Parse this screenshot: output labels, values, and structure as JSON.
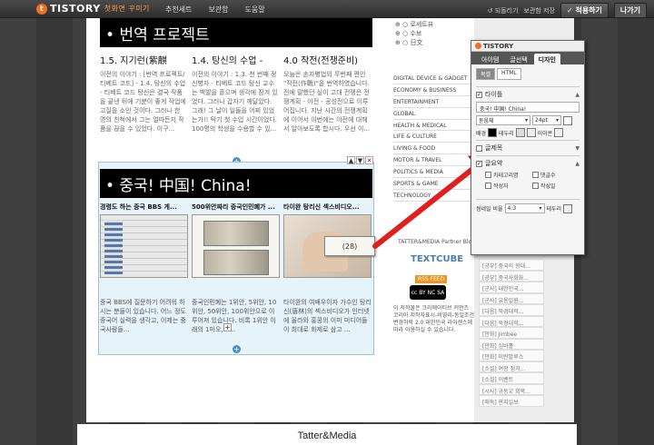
{
  "topbar": {
    "logo": "TISTORY",
    "logo_sub": "첫화면 꾸미기",
    "nav": [
      "추천세트",
      "보관함",
      "도움말"
    ],
    "undo": "되돌리기",
    "save_store": "보관함 저장",
    "apply": "적용하기",
    "exit": "나가기"
  },
  "blog": {
    "banner1": "• 번역 프로젝트",
    "posts1": [
      {
        "title": "1.5. 지기런(紫麒",
        "body": "이전의 이야기 : [번역 프로젝트/티베트 코드] - 1.4. 탕신의 수업 - 티베트 코드 탕신은 결국 작품을 끝낸 뒤에 기분이 좋게 작업에 고질을 소인 것이다. 그러나 한 명의 친척에서 그는 얼마든지 작품을 끊을 수 있었다. 이구..."
      },
      {
        "title": "1.4. 탕신의 수업 -",
        "body": "이전의 이야기 : 1.3. 천 번째 정신병자 - 티베트 코드 탕신 교수는 백발을 흩으며 생각에 잠겨 있었다. 그러나 갑자기 깨달았다. 그래! 그 날이 일들을 어찌 있었는가!! 탁기 첫 수업 시간이었다. 100명의 학생을 수용할 수 있..."
      },
      {
        "title": "4.0 작전(전쟁준비)",
        "body": "오늘은 손자병법의 무번째 편인 \"작전(作戰)\"을 번역하였습니다. 전에 말했던 싶이 고대 전쟁은 전쟁계획 - 야전 - 공성전으로 이루어집니다. 지난 시간의 전쟁계획에 이어서 이번에는 야전에 대해서 알아보도록 합시다. 우선 이..."
      }
    ],
    "banner2": "• 중국! 中国! China!",
    "posts2": [
      {
        "title": "경령도 하는 중국 BBS 게...",
        "body": "중국 BBS에 질문하기 어려워 하시는 분들이 있습니다. 어느 정도 중국어 실력을 생각고, 이제는 중국사람들..."
      },
      {
        "title": "500위안짜리 중국인민폐가 ...",
        "body": "중국인민폐는 1위안, 5위안, 10위안, 50위안, 100위안으로 이루어져 있습니다. 비록 1위안 이래의 1마오, 5..."
      },
      {
        "title": "타이완 탕리신 섹스비디오...",
        "body": "타이완의 여배우이자 가수인 탕리신(唐林)의 섹스비디오가 인터넷에 올라와 홍콩의 이미 미디어들이 최대로 화제로 삼고 ..."
      }
    ],
    "tooltip": "(28)",
    "footer": "Tatter&Media"
  },
  "sidebar": {
    "top_items": [
      "로세트뷰",
      "수보",
      "日文"
    ],
    "categories": [
      "DIGITAL DEVICE & GADGET",
      "ECONOMY & BUSINESS",
      "ENTERTAINMENT",
      "GLOBAL",
      "HEALTH & MEDICAL",
      "LIFE & CULTURE",
      "LIVING & FOOD",
      "MOTOR & TRAVEL",
      "POLITICS & MEDIA",
      "SPORTS & GAME",
      "TECHNOLOGY"
    ],
    "partner": "TATTER&MEDIA Partner Blog",
    "textcube": "TEXTCUBE",
    "rss": "RSS FEED",
    "cc": "cc BY NC SA",
    "license": "이 저작물은 크리에이티브 커먼즈 코리아 저작자표시-비영리-동일조건변경허락 2.0 대한민국 라이센스에 따라 이용하실 수 있습니다.",
    "right_list": [
      "[공부] 중국의 왕대...",
      "[공부] 중국사회화...",
      "[군사] 대한민국...",
      "[군사] 유용일원...",
      "[다음] 북경대학...",
      "[다음] 북경대학...",
      "[만화] Jimbee",
      "[만화] 심바홀",
      "[만화] 미란발루스",
      "[소설] 여왕 정치...",
      "[소설] 이벤트",
      "[시사] 규동교 회복...",
      "[애독] 판지일보"
    ]
  },
  "panel": {
    "title": "TISTORY",
    "tabs": [
      "아이템",
      "글선택",
      "디자인"
    ],
    "subtabs": [
      "복셀",
      "HTML"
    ],
    "section_title": "타이틀",
    "title_value": "중국! 中国! China!",
    "font": "돋움체",
    "size": "24pt",
    "bg_label": "배경",
    "border_label": "테두리",
    "icon_label": "이이콘",
    "section_list": "글제목",
    "section_summary": "글요약",
    "options": [
      "카테고리명",
      "댓글수",
      "작성자",
      "작성일"
    ],
    "ratio_label": "썸네일 비율",
    "ratio_value": "4:3",
    "border2_label": "테두리"
  },
  "colors": {
    "accent": "#f26c22",
    "arrow": "#e02020",
    "selection": "#9fc4da"
  }
}
